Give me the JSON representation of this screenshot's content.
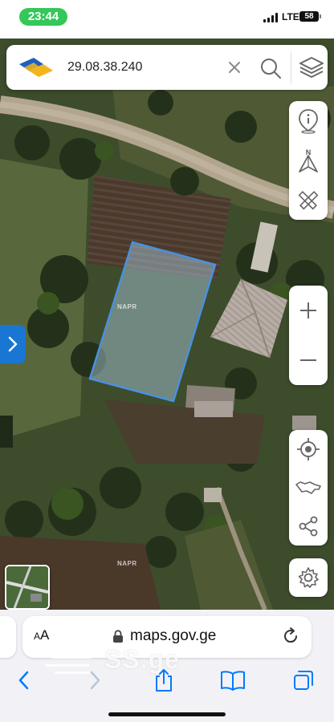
{
  "status_bar": {
    "time": "23:44",
    "network": "LTE",
    "battery": "58"
  },
  "search": {
    "value": "29.08.38.240",
    "clear_icon": "close-icon",
    "search_icon": "search-icon",
    "layers_icon": "layers-icon"
  },
  "map": {
    "type": "satellite",
    "watermarks": [
      "NAPR",
      "NAPR"
    ],
    "selected_parcel_color": "#4a90e2",
    "tools": [
      "info-pin-icon",
      "compass-icon",
      "ruler-pencil-icon"
    ],
    "zoom": [
      "zoom-in-icon",
      "zoom-out-icon"
    ],
    "navigation": [
      "locate-icon",
      "georgia-map-icon",
      "share-icon"
    ],
    "settings_icon": "gear-icon",
    "side_panel_toggle_icon": "chevron-right-icon"
  },
  "browser": {
    "text_size_label_big": "A",
    "text_size_label_small": "A",
    "url": "maps.gov.ge",
    "watermark": "SS.ge",
    "toolbar": [
      "back-icon",
      "forward-icon",
      "share-icon",
      "bookmarks-icon",
      "tabs-icon"
    ],
    "accent": "#007aff"
  }
}
